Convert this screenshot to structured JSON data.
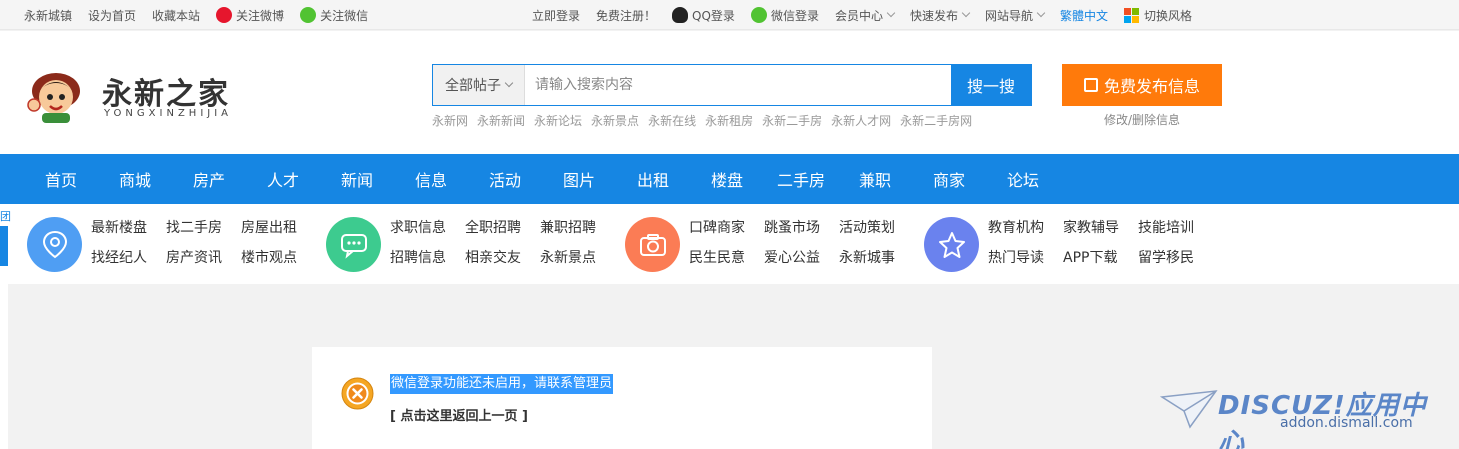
{
  "topbar": {
    "left": [
      "永新城镇",
      "设为首页",
      "收藏本站",
      "关注微博",
      "关注微信"
    ],
    "login": "立即登录",
    "register": "免费注册！",
    "qq_login": "QQ登录",
    "wechat_login": "微信登录",
    "member_center": "会员中心",
    "quick_publish": "快速发布",
    "site_nav": "网站导航",
    "traditional": "繁體中文",
    "switch_style": "切换风格"
  },
  "logo": {
    "name": "永新之家",
    "pinyin": "YONGXINZHIJIA"
  },
  "search": {
    "category": "全部帖子",
    "placeholder": "请输入搜索内容",
    "button": "搜一搜",
    "hot": [
      "永新网",
      "永新新闻",
      "永新论坛",
      "永新景点",
      "永新在线",
      "永新租房",
      "永新二手房",
      "永新人才网",
      "永新二手房网"
    ]
  },
  "publish": {
    "button": "免费发布信息",
    "edit": "修改/删除信息"
  },
  "nav": [
    "首页",
    "商城",
    "房产",
    "人才",
    "新闻",
    "信息",
    "活动",
    "图片",
    "出租",
    "楼盘",
    "二手房",
    "兼职",
    "商家",
    "论坛"
  ],
  "quick": [
    {
      "icon": "location-pin-icon",
      "color": "#4f9ef3",
      "items": [
        "最新楼盘",
        "找二手房",
        "房屋出租",
        "找经纪人",
        "房产资讯",
        "楼市观点"
      ]
    },
    {
      "icon": "chat-bubble-icon",
      "color": "#3dcb8f",
      "items": [
        "求职信息",
        "全职招聘",
        "兼职招聘",
        "招聘信息",
        "相亲交友",
        "永新景点"
      ]
    },
    {
      "icon": "camera-icon",
      "color": "#fb7c55",
      "items": [
        "口碑商家",
        "跳蚤市场",
        "活动策划",
        "民生民意",
        "爱心公益",
        "永新城事"
      ]
    },
    {
      "icon": "star-icon",
      "color": "#6a82ee",
      "items": [
        "教育机构",
        "家教辅导",
        "技能培训",
        "热门导读",
        "APP下载",
        "留学移民"
      ]
    }
  ],
  "edge_tab": "团",
  "message": {
    "text": "微信登录功能还未启用，请联系管理员",
    "back": "[ 点击这里返回上一页 ]"
  },
  "watermark": {
    "brand": "DISCUZ!应用中心",
    "url": "addon.dismall.com"
  }
}
